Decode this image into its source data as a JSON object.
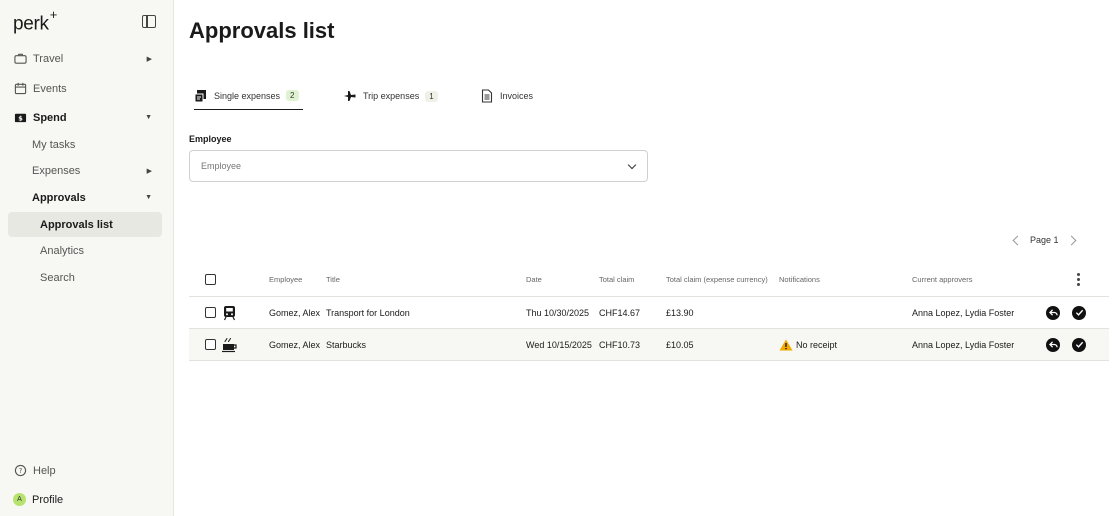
{
  "app": {
    "logo": "perk",
    "logo_sup": "+"
  },
  "sidebar": {
    "items": [
      {
        "label": "Travel"
      },
      {
        "label": "Events"
      },
      {
        "label": "Spend"
      },
      {
        "label": "My tasks"
      },
      {
        "label": "Expenses"
      },
      {
        "label": "Approvals"
      },
      {
        "label": "Approvals list"
      },
      {
        "label": "Analytics"
      },
      {
        "label": "Search"
      }
    ],
    "help": "Help",
    "profile": "Profile",
    "avatar_initial": "A"
  },
  "page": {
    "title": "Approvals list"
  },
  "tabs": [
    {
      "label": "Single expenses",
      "count": "2"
    },
    {
      "label": "Trip expenses",
      "count": "1"
    },
    {
      "label": "Invoices"
    }
  ],
  "filter": {
    "label": "Employee",
    "placeholder": "Employee"
  },
  "pager": {
    "label": "Page 1"
  },
  "table": {
    "headers": [
      "Employee",
      "Title",
      "Date",
      "Total claim",
      "Total claim (expense currency)",
      "Notifications",
      "Current approvers"
    ],
    "rows": [
      {
        "employee": "Gomez, Alex",
        "title": "Transport for London",
        "date": "Thu 10/30/2025",
        "total": "CHF14.67",
        "total_expense": "£13.90",
        "notification": "",
        "approvers": "Anna Lopez, Lydia Foster"
      },
      {
        "employee": "Gomez, Alex",
        "title": "Starbucks",
        "date": "Wed 10/15/2025",
        "total": "CHF10.73",
        "total_expense": "£10.05",
        "notification": "No receipt",
        "approvers": "Anna Lopez, Lydia Foster"
      }
    ]
  },
  "colors": {
    "sidebar_bg": "#f7f7f3",
    "active_bg": "#e8e8e2",
    "avatar": "#b6e36e",
    "warning": "#f2a900"
  }
}
